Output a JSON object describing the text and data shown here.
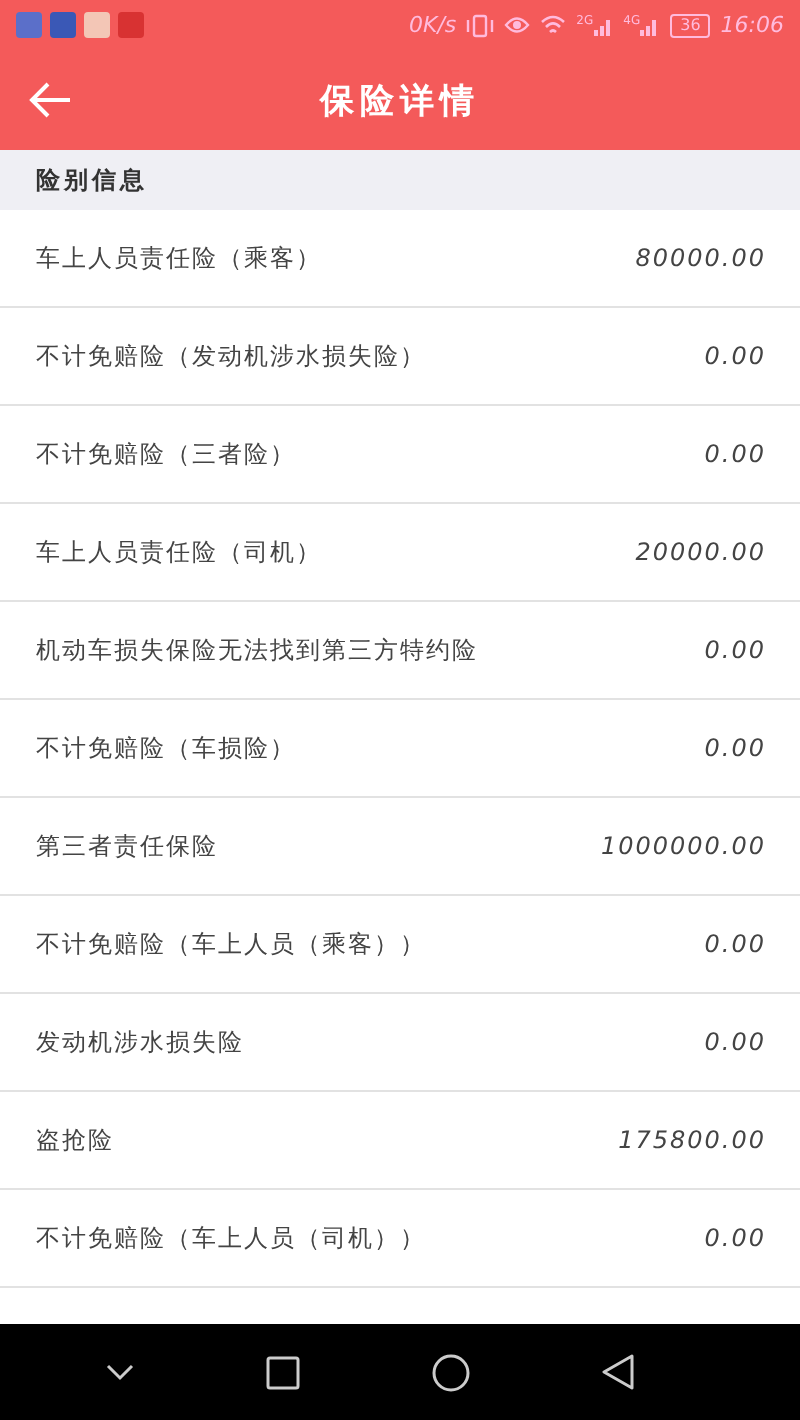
{
  "status_bar": {
    "speed": "0K/s",
    "signal_1": "2G",
    "signal_2": "4G",
    "battery": "36",
    "time": "16:06"
  },
  "header": {
    "title": "保险详情"
  },
  "section": {
    "title": "险别信息"
  },
  "rows": [
    {
      "name": "车上人员责任险（乘客）",
      "amount": "80000.00"
    },
    {
      "name": "不计免赔险（发动机涉水损失险）",
      "amount": "0.00"
    },
    {
      "name": "不计免赔险（三者险）",
      "amount": "0.00"
    },
    {
      "name": "车上人员责任险（司机）",
      "amount": "20000.00"
    },
    {
      "name": "机动车损失保险无法找到第三方特约险",
      "amount": "0.00"
    },
    {
      "name": "不计免赔险（车损险）",
      "amount": "0.00"
    },
    {
      "name": "第三者责任保险",
      "amount": "1000000.00"
    },
    {
      "name": "不计免赔险（车上人员（乘客））",
      "amount": "0.00"
    },
    {
      "name": "发动机涉水损失险",
      "amount": "0.00"
    },
    {
      "name": "盗抢险",
      "amount": "175800.00"
    },
    {
      "name": "不计免赔险（车上人员（司机））",
      "amount": "0.00"
    }
  ]
}
